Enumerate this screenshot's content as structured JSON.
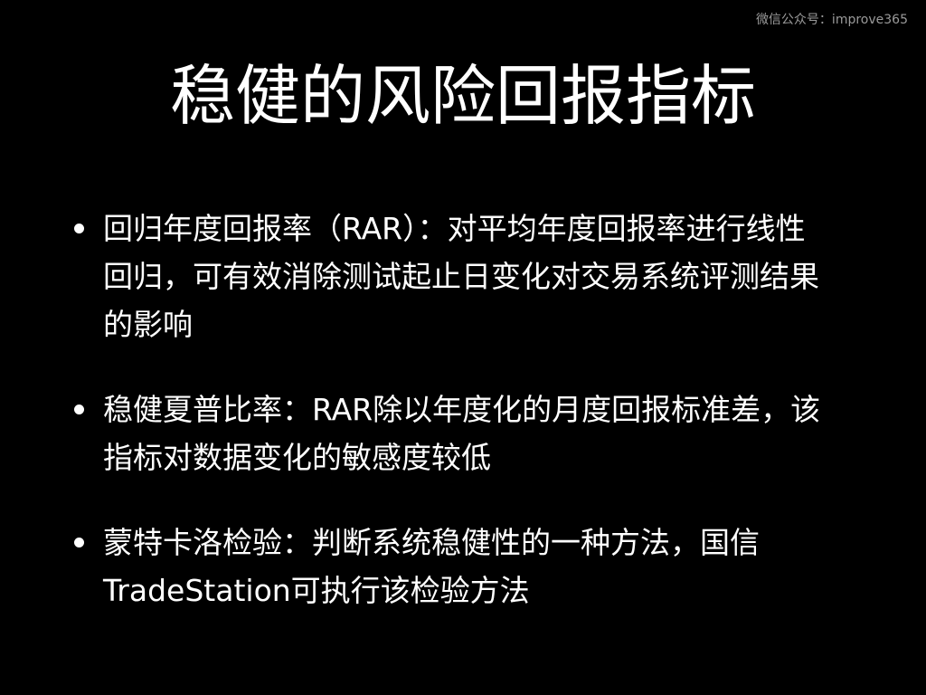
{
  "watermark": "微信公众号：improve365",
  "title": "稳健的风险回报指标",
  "bullets": [
    {
      "text": "回归年度回报率（RAR）：对平均年度回报率进行线性回归，可有效消除测试起止日变化对交易系统评测结果的影响"
    },
    {
      "text": "稳健夏普比率：RAR除以年度化的月度回报标准差，该指标对数据变化的敏感度较低"
    },
    {
      "text": "蒙特卡洛检验：判断系统稳健性的一种方法，国信TradeStation可执行该检验方法"
    }
  ],
  "colors": {
    "background": "#000000",
    "text": "#ffffff",
    "watermark": "#9a9a9a"
  }
}
